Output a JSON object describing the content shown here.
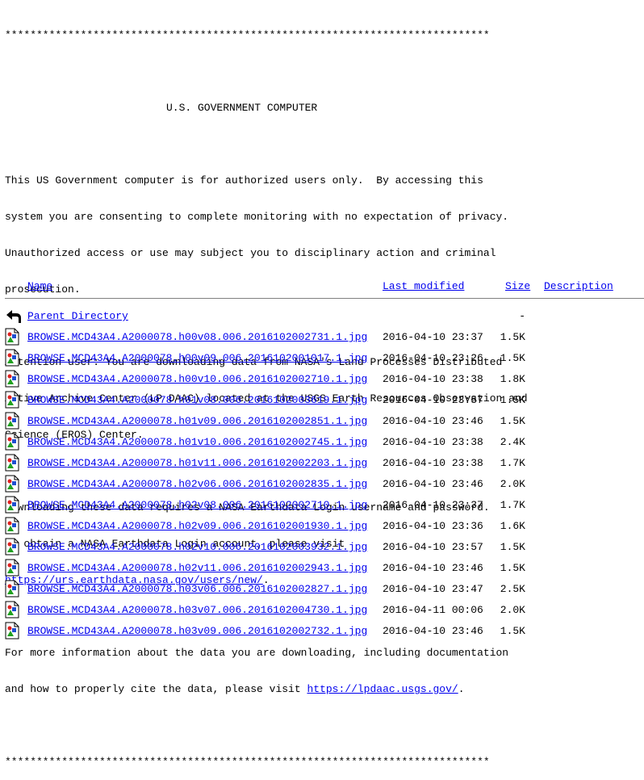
{
  "banner": {
    "stars_line": "*****************************************************************************",
    "title": "U.S. GOVERNMENT COMPUTER",
    "para1": [
      "This US Government computer is for authorized users only.  By accessing this",
      "system you are consenting to complete monitoring with no expectation of privacy.",
      "Unauthorized access or use may subject you to disciplinary action and criminal",
      "prosecution."
    ],
    "para2": [
      "Attention user: You are downloading data from NASA's Land Processes Distributed",
      "Active Archive Center (LP DAAC) located at the USGS Earth Resources Observation and",
      "Science (EROS) Center."
    ],
    "para3_lines": [
      "Downloading these data requires a NASA Earthdata Login username and password.",
      "To obtain a NASA Earthdata Login account, please visit"
    ],
    "para3_link": "https://urs.earthdata.nasa.gov/users/new/",
    "para3_tail": ".",
    "para4_line1": "For more information about the data you are downloading, including documentation",
    "para4_line2_prefix": "and how to properly cite the data, please visit ",
    "para4_link": "https://lpdaac.usgs.gov/",
    "para4_tail": "."
  },
  "table": {
    "headers": {
      "name": "Name",
      "last_modified": "Last modified",
      "size": "Size",
      "description": "Description"
    },
    "parent": {
      "label": "Parent Directory",
      "size": "-"
    },
    "rows": [
      {
        "name": "BROWSE.MCD43A4.A2000078.h00v08.006.2016102002731.1.jpg",
        "modified": "2016-04-10 23:37",
        "size": "1.5K"
      },
      {
        "name": "BROWSE.MCD43A4.A2000078.h00v09.006.2016102001017.1.jpg",
        "modified": "2016-04-10 23:26",
        "size": "1.5K"
      },
      {
        "name": "BROWSE.MCD43A4.A2000078.h00v10.006.2016102002710.1.jpg",
        "modified": "2016-04-10 23:38",
        "size": "1.8K"
      },
      {
        "name": "BROWSE.MCD43A4.A2000078.h01v08.006.2016102003619.1.jpg",
        "modified": "2016-04-10 23:57",
        "size": "1.5K"
      },
      {
        "name": "BROWSE.MCD43A4.A2000078.h01v09.006.2016102002851.1.jpg",
        "modified": "2016-04-10 23:46",
        "size": "1.5K"
      },
      {
        "name": "BROWSE.MCD43A4.A2000078.h01v10.006.2016102002745.1.jpg",
        "modified": "2016-04-10 23:38",
        "size": "2.4K"
      },
      {
        "name": "BROWSE.MCD43A4.A2000078.h01v11.006.2016102002203.1.jpg",
        "modified": "2016-04-10 23:38",
        "size": "1.7K"
      },
      {
        "name": "BROWSE.MCD43A4.A2000078.h02v06.006.2016102002835.1.jpg",
        "modified": "2016-04-10 23:46",
        "size": "2.0K"
      },
      {
        "name": "BROWSE.MCD43A4.A2000078.h02v08.006.2016102002710.1.jpg",
        "modified": "2016-04-10 23:37",
        "size": "1.7K"
      },
      {
        "name": "BROWSE.MCD43A4.A2000078.h02v09.006.2016102001930.1.jpg",
        "modified": "2016-04-10 23:36",
        "size": "1.6K"
      },
      {
        "name": "BROWSE.MCD43A4.A2000078.h02v10.006.2016102003932.1.jpg",
        "modified": "2016-04-10 23:57",
        "size": "1.5K"
      },
      {
        "name": "BROWSE.MCD43A4.A2000078.h02v11.006.2016102002943.1.jpg",
        "modified": "2016-04-10 23:46",
        "size": "1.5K"
      },
      {
        "name": "BROWSE.MCD43A4.A2000078.h03v06.006.2016102002827.1.jpg",
        "modified": "2016-04-10 23:47",
        "size": "2.5K"
      },
      {
        "name": "BROWSE.MCD43A4.A2000078.h03v07.006.2016102004730.1.jpg",
        "modified": "2016-04-11 00:06",
        "size": "2.0K"
      },
      {
        "name": "BROWSE.MCD43A4.A2000078.h03v09.006.2016102002732.1.jpg",
        "modified": "2016-04-10 23:46",
        "size": "1.5K"
      }
    ]
  },
  "colors": {
    "link": "#0000ee",
    "rule": "#808080"
  },
  "icons": {
    "parent": "back-arrow-icon",
    "file": "image-file-icon"
  }
}
